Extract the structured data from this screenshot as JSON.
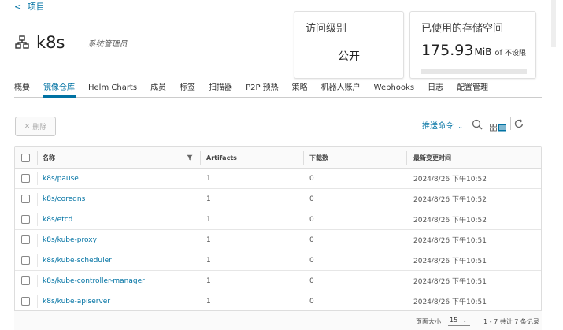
{
  "nav": {
    "back_arrow": "<",
    "back_label": "项目"
  },
  "project": {
    "name": "k8s",
    "role": "系统管理员",
    "icon": "project-icon"
  },
  "access_card": {
    "title": "访问级别",
    "value": "公开"
  },
  "storage_card": {
    "title": "已使用的存储空间",
    "used": "175.93",
    "unit": "MiB",
    "of": "of",
    "limit": "不设限"
  },
  "tabs": [
    {
      "label": "概要",
      "active": false
    },
    {
      "label": "镜像仓库",
      "active": true
    },
    {
      "label": "Helm Charts",
      "active": false
    },
    {
      "label": "成员",
      "active": false
    },
    {
      "label": "标签",
      "active": false
    },
    {
      "label": "扫描器",
      "active": false
    },
    {
      "label": "P2P 预热",
      "active": false
    },
    {
      "label": "策略",
      "active": false
    },
    {
      "label": "机器人账户",
      "active": false
    },
    {
      "label": "Webhooks",
      "active": false
    },
    {
      "label": "日志",
      "active": false
    },
    {
      "label": "配置管理",
      "active": false
    }
  ],
  "toolbar": {
    "delete_label": "删除",
    "push_command_label": "推送命令"
  },
  "table": {
    "headers": {
      "name": "名称",
      "artifacts": "Artifacts",
      "downloads": "下载数",
      "modified": "最新变更时间"
    },
    "rows": [
      {
        "name": "k8s/pause",
        "artifacts": "1",
        "downloads": "0",
        "modified": "2024/8/26 下午10:52"
      },
      {
        "name": "k8s/coredns",
        "artifacts": "1",
        "downloads": "0",
        "modified": "2024/8/26 下午10:52"
      },
      {
        "name": "k8s/etcd",
        "artifacts": "1",
        "downloads": "0",
        "modified": "2024/8/26 下午10:52"
      },
      {
        "name": "k8s/kube-proxy",
        "artifacts": "1",
        "downloads": "0",
        "modified": "2024/8/26 下午10:51"
      },
      {
        "name": "k8s/kube-scheduler",
        "artifacts": "1",
        "downloads": "0",
        "modified": "2024/8/26 下午10:51"
      },
      {
        "name": "k8s/kube-controller-manager",
        "artifacts": "1",
        "downloads": "0",
        "modified": "2024/8/26 下午10:51"
      },
      {
        "name": "k8s/kube-apiserver",
        "artifacts": "1",
        "downloads": "0",
        "modified": "2024/8/26 下午10:51"
      }
    ]
  },
  "pagination": {
    "page_size_label": "页面大小",
    "page_size": "15",
    "summary": "1 - 7 共计 7 条记录"
  },
  "colors": {
    "accent": "#0072a3",
    "text": "#333333",
    "border": "#dddddd"
  }
}
